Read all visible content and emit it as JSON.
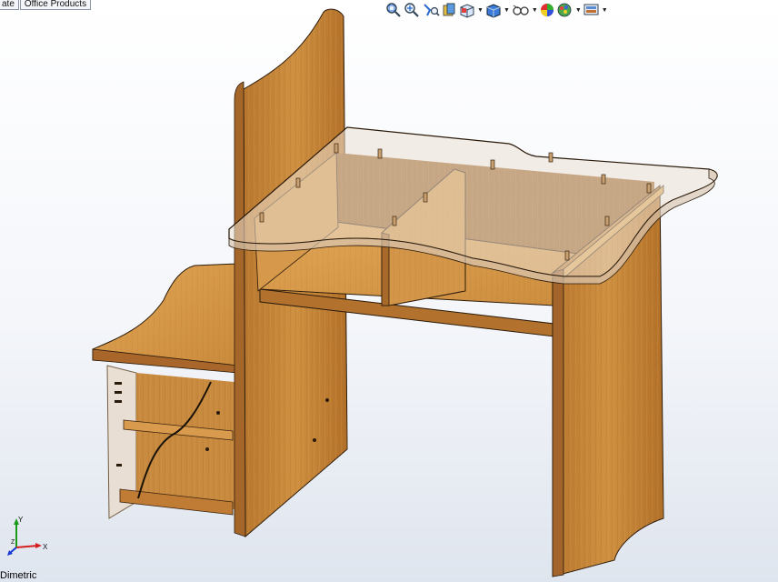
{
  "tabs": [
    {
      "label": "ate"
    },
    {
      "label": "Office Products"
    }
  ],
  "toolbar": {
    "items": [
      {
        "name": "zoom-to-fit-icon",
        "dropdown": false
      },
      {
        "name": "zoom-to-area-icon",
        "dropdown": false
      },
      {
        "name": "previous-view-icon",
        "dropdown": false
      },
      {
        "name": "section-view-icon",
        "dropdown": false
      },
      {
        "name": "view-orientation-icon",
        "dropdown": true
      },
      {
        "name": "display-style-icon",
        "dropdown": true
      },
      {
        "name": "hide-show-items-icon",
        "dropdown": true
      },
      {
        "name": "edit-appearance-icon",
        "dropdown": false
      },
      {
        "name": "apply-scene-icon",
        "dropdown": true
      },
      {
        "name": "view-settings-icon",
        "dropdown": true
      }
    ]
  },
  "triad": {
    "x_label": "X",
    "y_label": "Y",
    "z_label": "Z"
  },
  "view": {
    "orientation_label": "Dimetric"
  },
  "colors": {
    "wood_face": "#c98a3a",
    "wood_light": "#dca053",
    "wood_dark": "#8a5a20",
    "glass": "#e9ddd0",
    "edge": "#2a1a0a",
    "axis_x": "#d42020",
    "axis_y": "#1a9a1a",
    "axis_z": "#1a3ad4"
  }
}
